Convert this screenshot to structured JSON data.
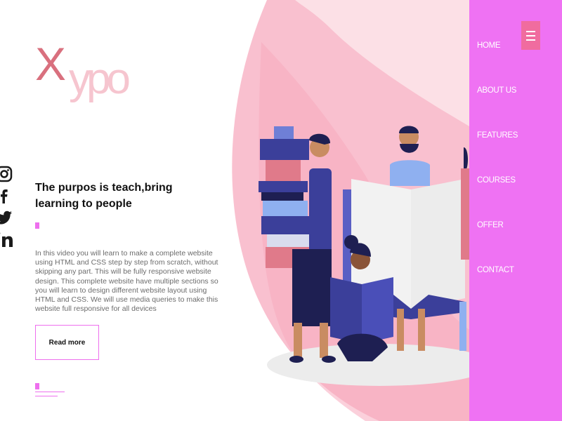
{
  "logo": {
    "first_letter": "X",
    "rest": "ypo"
  },
  "social": [
    {
      "name": "instagram-icon"
    },
    {
      "name": "facebook-icon"
    },
    {
      "name": "twitter-icon"
    },
    {
      "name": "linkedin-icon"
    }
  ],
  "hero": {
    "headline": "The purpos is teach,bring learning to people",
    "description": "In this video you will learn to make a complete website using HTML and CSS step by step from scratch, without skipping any part. This will be fully responsive website design. This complete website have multiple sections so you will learn to design different website layout using HTML and CSS. We will use media queries to make this website full responsive for all devices",
    "button_label": "Read more"
  },
  "nav": {
    "items": [
      "HOME",
      "ABOUT US",
      "FEATURES",
      "COURSES",
      "OFFER",
      "CONTACT"
    ],
    "menu_icon": "hamburger-icon"
  },
  "colors": {
    "accent": "#ee6fee",
    "sidebar": "#ef72f3",
    "menu_button": "#f06c9f",
    "logo_x": "#d9707e",
    "logo_rest": "#f6c5cf",
    "blob_pink": "#f9c0cf",
    "blob_light": "#fce0e6"
  }
}
